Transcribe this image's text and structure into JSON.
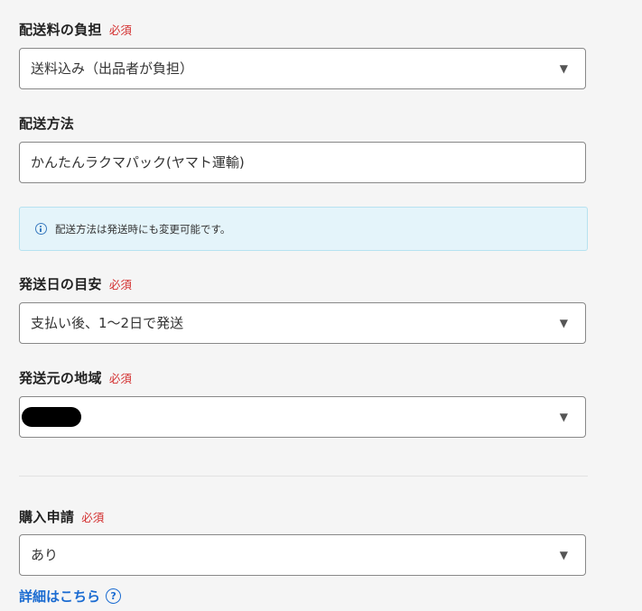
{
  "shipping_fee": {
    "label": "配送料の負担",
    "required": "必須",
    "value": "送料込み（出品者が負担）",
    "caret_icon": "triangle-down"
  },
  "shipping_method": {
    "label": "配送方法",
    "value": "かんたんラクマパック(ヤマト運輸)"
  },
  "notice": {
    "icon": "info-icon",
    "text": "配送方法は発送時にも変更可能です。"
  },
  "shipping_days": {
    "label": "発送日の目安",
    "required": "必須",
    "value": "支払い後、1〜2日で発送",
    "caret_icon": "triangle-down"
  },
  "origin_region": {
    "label": "発送元の地域",
    "required": "必須",
    "value": "",
    "caret_icon": "triangle-down"
  },
  "purchase_request": {
    "label": "購入申請",
    "required": "必須",
    "value": "あり",
    "caret_icon": "triangle-down"
  },
  "detail_link": {
    "label": "詳細はこちら",
    "icon_glyph": "?"
  },
  "colors": {
    "required": "#d32f2f",
    "link": "#1a6bd1",
    "notice_bg": "#e4f4fa",
    "page_bg": "#f5f5f5"
  }
}
